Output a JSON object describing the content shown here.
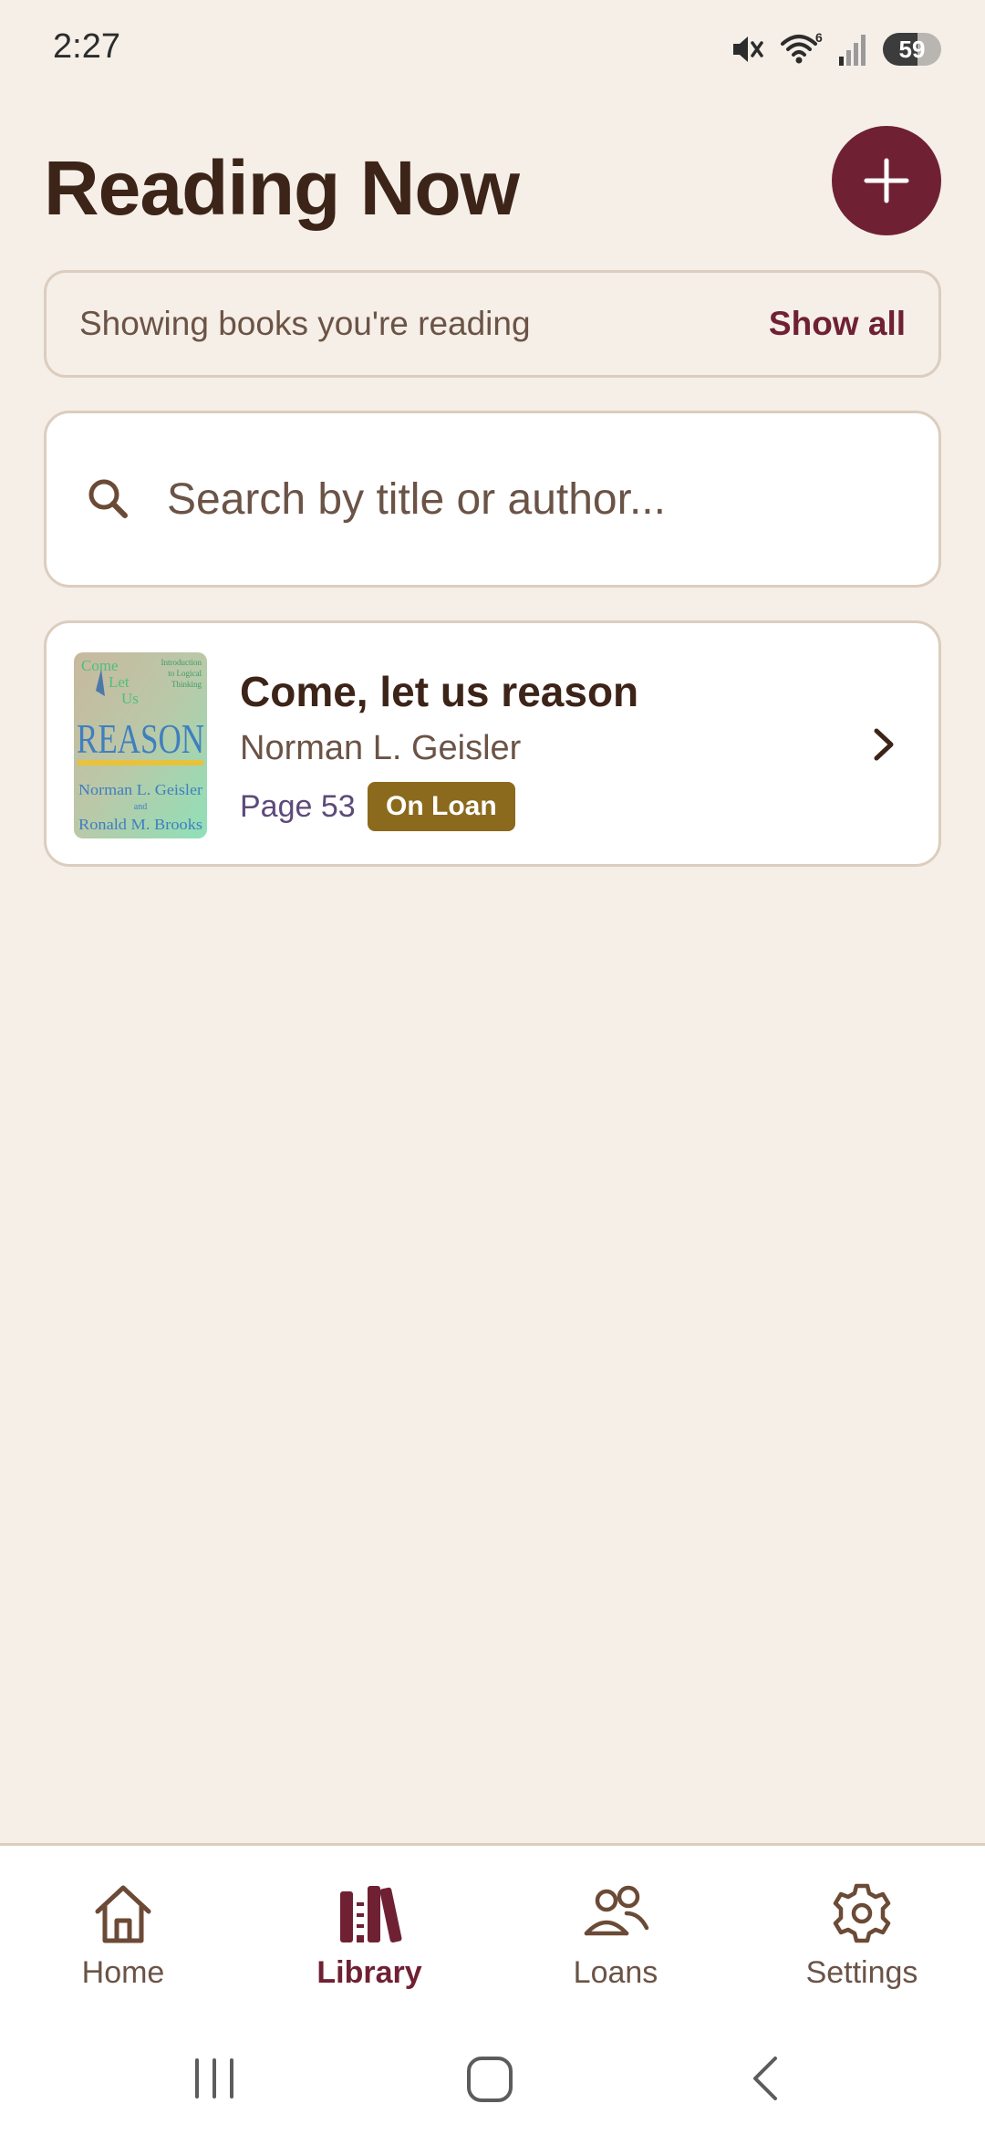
{
  "status_bar": {
    "time": "2:27",
    "battery": "59",
    "battery_level_percent": 59,
    "wifi_badge": "6",
    "icons": [
      "mute-icon",
      "wifi-icon",
      "signal-icon",
      "battery-icon"
    ]
  },
  "header": {
    "title": "Reading Now",
    "add_icon": "plus-icon"
  },
  "filter": {
    "text": "Showing books you're reading",
    "action_label": "Show all"
  },
  "search": {
    "placeholder": "Search by title or author..."
  },
  "books": [
    {
      "title": "Come, let us reason",
      "author": "Norman L. Geisler",
      "page": "Page 53",
      "badge": "On Loan",
      "cover": {
        "line1": "Come",
        "line2": "Let",
        "line3": "Us",
        "main": "REASON",
        "subtitle_1": "Introduction",
        "subtitle_2": "to Logical",
        "subtitle_3": "Thinking",
        "author_1": "Norman L. Geisler",
        "and": "and",
        "author_2": "Ronald M. Brooks"
      }
    }
  ],
  "bottom_nav": {
    "items": [
      {
        "label": "Home",
        "icon": "home-icon",
        "active": false
      },
      {
        "label": "Library",
        "icon": "library-icon",
        "active": true
      },
      {
        "label": "Loans",
        "icon": "people-icon",
        "active": false
      },
      {
        "label": "Settings",
        "icon": "gear-icon",
        "active": false
      }
    ]
  },
  "colors": {
    "background": "#f5efe8",
    "accent": "#6f2133",
    "text_primary": "#3d2418",
    "text_secondary": "#6b5346",
    "badge": "#8b6a1d",
    "border": "#dccdbe"
  }
}
